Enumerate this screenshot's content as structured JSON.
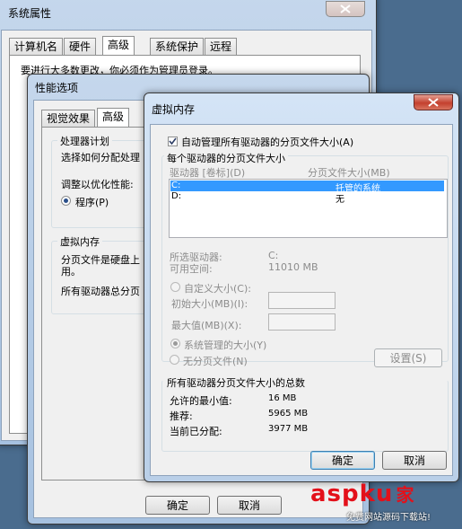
{
  "system_properties": {
    "title": "系统属性",
    "tabs": [
      "计算机名",
      "硬件",
      "高级",
      "系统保护",
      "远程"
    ],
    "active_tab": "高级",
    "partial_text": "要进行大多数更改，你必须作为管理员登录。"
  },
  "performance_options": {
    "title": "性能选项",
    "tabs": [
      "视觉效果",
      "高级"
    ],
    "active_tab": "高级",
    "processor_group": "处理器计划",
    "processor_desc": "选择如何分配处理",
    "adjust_label": "调整以优化性能:",
    "programs_radio": "程序(P)",
    "vm_group": "虚拟内存",
    "vm_desc_line1": "分页文件是硬盘上",
    "vm_desc_line2": "用。",
    "vm_total": "所有驱动器总分页",
    "ok_label": "确定",
    "cancel_label": "取消"
  },
  "virtual_memory": {
    "title": "虚拟内存",
    "auto_manage_label": "自动管理所有驱动器的分页文件大小(A)",
    "auto_manage_checked": true,
    "per_drive_group": "每个驱动器的分页文件大小",
    "col_drive": "驱动器 [卷标](D)",
    "col_size": "分页文件大小(MB)",
    "drives": [
      {
        "drive": "C:",
        "size": "托管的系统"
      },
      {
        "drive": "D:",
        "size": "无"
      }
    ],
    "selected_drive_label": "所选驱动器:",
    "selected_drive_value": "C:",
    "free_space_label": "可用空间:",
    "free_space_value": "11010 MB",
    "custom_size_label": "自定义大小(C):",
    "initial_size_label": "初始大小(MB)(I):",
    "max_size_label": "最大值(MB)(X):",
    "system_managed_label": "系统管理的大小(Y)",
    "no_paging_label": "无分页文件(N)",
    "set_label": "设置(S)",
    "totals_group": "所有驱动器分页文件大小的总数",
    "min_allowed_label": "允许的最小值:",
    "min_allowed_value": "16 MB",
    "recommended_label": "推荐:",
    "recommended_value": "5965 MB",
    "allocated_label": "当前已分配:",
    "allocated_value": "3977 MB",
    "ok_label": "确定",
    "cancel_label": "取消"
  },
  "watermark": {
    "brand": "aspku",
    "brand_suffix": "家",
    "slogan": "免费网站源码下载站!"
  }
}
